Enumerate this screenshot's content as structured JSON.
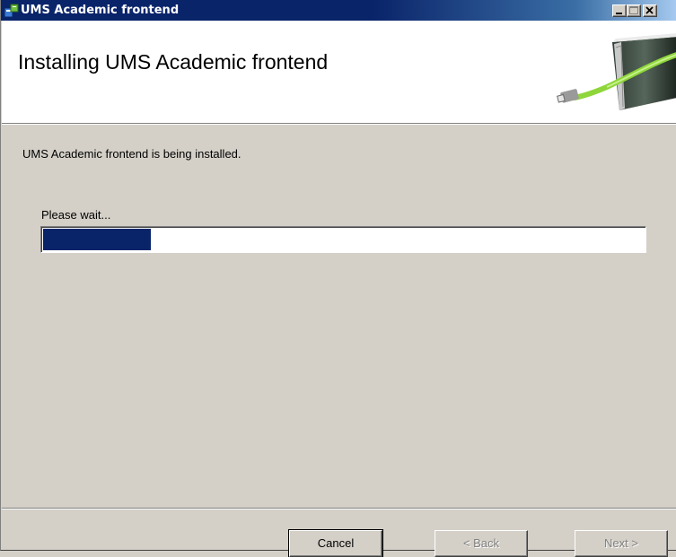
{
  "window": {
    "title": "UMS Academic frontend"
  },
  "header": {
    "title": "Installing UMS Academic frontend"
  },
  "body": {
    "status_text": "UMS Academic frontend is being installed.",
    "wait_text": "Please wait...",
    "progress_fraction": 0.18
  },
  "buttons": {
    "cancel": "Cancel",
    "back": "< Back",
    "next": "Next >"
  },
  "colors": {
    "titlebar": "#0a246a",
    "progress": "#0a246a",
    "dialog_bg": "#d4d0c8"
  },
  "icons": {
    "app": "installer-icon",
    "header_graphic": "book-usb-cable-graphic",
    "minimize": "minimize-icon",
    "maximize": "maximize-icon",
    "close": "close-icon"
  }
}
